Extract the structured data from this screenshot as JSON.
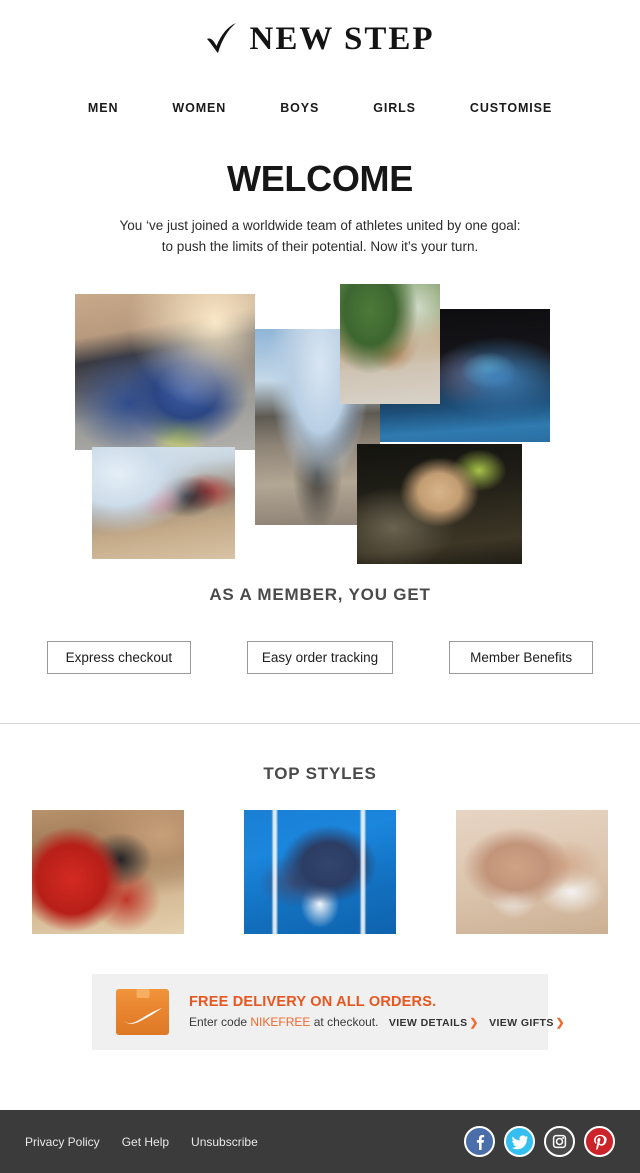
{
  "brand": {
    "name": "NEW STEP",
    "logo_icon": "checkmark-icon"
  },
  "nav": {
    "items": [
      {
        "label": "MEN"
      },
      {
        "label": "WOMEN"
      },
      {
        "label": "BOYS"
      },
      {
        "label": "GIRLS"
      },
      {
        "label": "CUSTOMISE"
      }
    ]
  },
  "hero": {
    "title": "WELCOME",
    "subtitle_line1": "You ‘ve just joined a worldwide team of athletes united by one goal:",
    "subtitle_line2": "to push the limits of their potential. Now it’s your turn."
  },
  "collage": {
    "photos": [
      {
        "alt": "runner tying blue sneaker laces on pavement"
      },
      {
        "alt": "athlete running on an open road"
      },
      {
        "alt": "woman in yellow sports bra crouching to tie her shoes"
      },
      {
        "alt": "woman stretching on a blue gym mat"
      },
      {
        "alt": "women in a step aerobics class at the gym"
      },
      {
        "alt": "woman training with battle ropes in a gym"
      }
    ]
  },
  "member": {
    "title": "AS A MEMBER, YOU GET",
    "buttons": [
      {
        "label": "Express checkout"
      },
      {
        "label": "Easy order tracking"
      },
      {
        "label": "Member Benefits"
      }
    ]
  },
  "styles": {
    "title": "TOP STYLES",
    "products": [
      {
        "alt": "red bowling ball beside black and red bowling shoes"
      },
      {
        "alt": "navy blue canvas sneakers on blue background"
      },
      {
        "alt": "tan canvas sneakers with white toe caps"
      }
    ]
  },
  "promo": {
    "icon": "delivery-box-icon",
    "headline": "FREE DELIVERY ON ALL ORDERS.",
    "sub_before": "Enter code",
    "code": "NIKEFREE",
    "sub_after": "at checkout.",
    "link_details": "VIEW DETAILS",
    "link_gifts": "VIEW GIFTS",
    "chevron": "❯",
    "accent_color": "#e8561f",
    "box_color": "#ea8630",
    "bg_color": "#f0f0f0"
  },
  "footer": {
    "bg_color": "#3b3b3b",
    "links": [
      {
        "label": "Privacy Policy"
      },
      {
        "label": "Get Help"
      },
      {
        "label": "Unsubscribe"
      }
    ],
    "socials": [
      {
        "name": "facebook",
        "color": "#4a6ea9"
      },
      {
        "name": "twitter",
        "color": "#34bff0"
      },
      {
        "name": "instagram",
        "color": "#4a4a4a"
      },
      {
        "name": "pinterest",
        "color": "#cc2229"
      }
    ]
  }
}
